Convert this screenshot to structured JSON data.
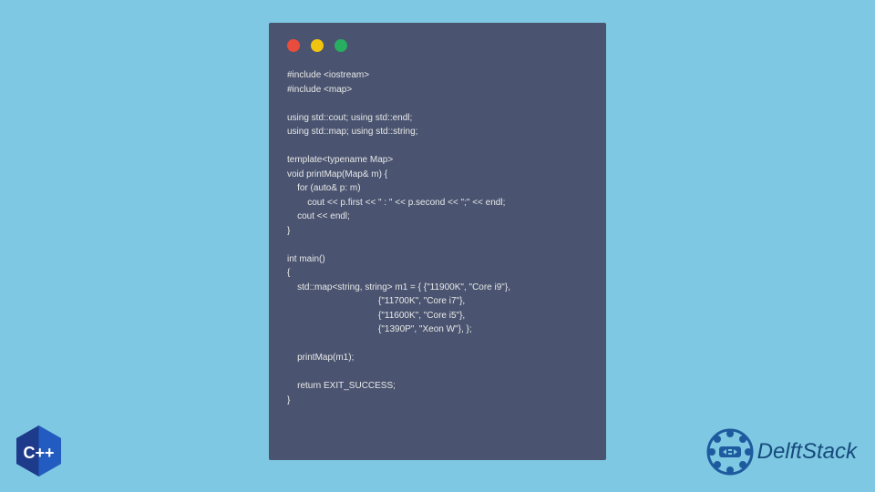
{
  "code": {
    "lines": [
      "#include <iostream>",
      "#include <map>",
      "",
      "using std::cout; using std::endl;",
      "using std::map; using std::string;",
      "",
      "template<typename Map>",
      "void printMap(Map& m) {",
      "    for (auto& p: m)",
      "        cout << p.first << \" : \" << p.second << \";\" << endl;",
      "    cout << endl;",
      "}",
      "",
      "int main()",
      "{",
      "    std::map<string, string> m1 = { {\"11900K\", \"Core i9\"},",
      "                                    {\"11700K\", \"Core i7\"},",
      "                                    {\"11600K\", \"Core i5\"},",
      "                                    {\"1390P\", \"Xeon W\"}, };",
      "",
      "    printMap(m1);",
      "",
      "    return EXIT_SUCCESS;",
      "}"
    ]
  },
  "badges": {
    "cpp_label": "C++",
    "brand_name": "DelftStack"
  },
  "colors": {
    "bg": "#7EC8E3",
    "window": "#4A5470",
    "red": "#E74C3C",
    "yellow": "#F1C40F",
    "green": "#27AE60",
    "cpp_blue": "#1E3A8A",
    "ds_blue": "#164A7C"
  }
}
